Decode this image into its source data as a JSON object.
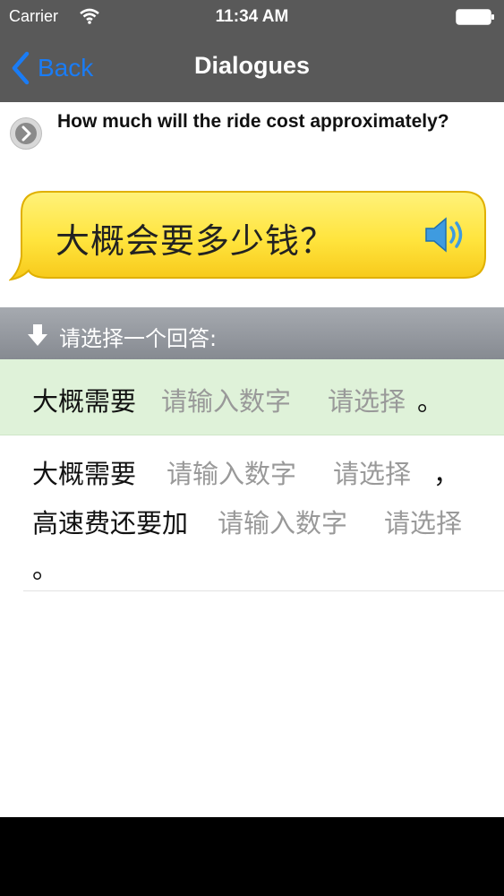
{
  "status_bar": {
    "carrier": "Carrier",
    "time": "11:34 AM"
  },
  "nav": {
    "back_label": "Back",
    "title": "Dialogues"
  },
  "question": {
    "english": "How much will the ride cost approximately?",
    "chinese": "大概会要多少钱？"
  },
  "section": {
    "title": "请选择一个回答:"
  },
  "answers": [
    {
      "text_1": "大概需要",
      "input_placeholder": "请输入数字",
      "select_label": "请选择",
      "end": "。"
    },
    {
      "text_1": "大概需要",
      "input_placeholder": "请输入数字",
      "select_label": "请选择",
      "comma": "，",
      "text_2": "高速费还要加",
      "input_placeholder_2": "请输入数字",
      "select_label_2": "请选择",
      "end": "。"
    }
  ],
  "colors": {
    "nav_background": "#595959",
    "accent": "#1a7cf5",
    "bubble": "#ffe84a",
    "selected_row": "#dff2d9"
  }
}
